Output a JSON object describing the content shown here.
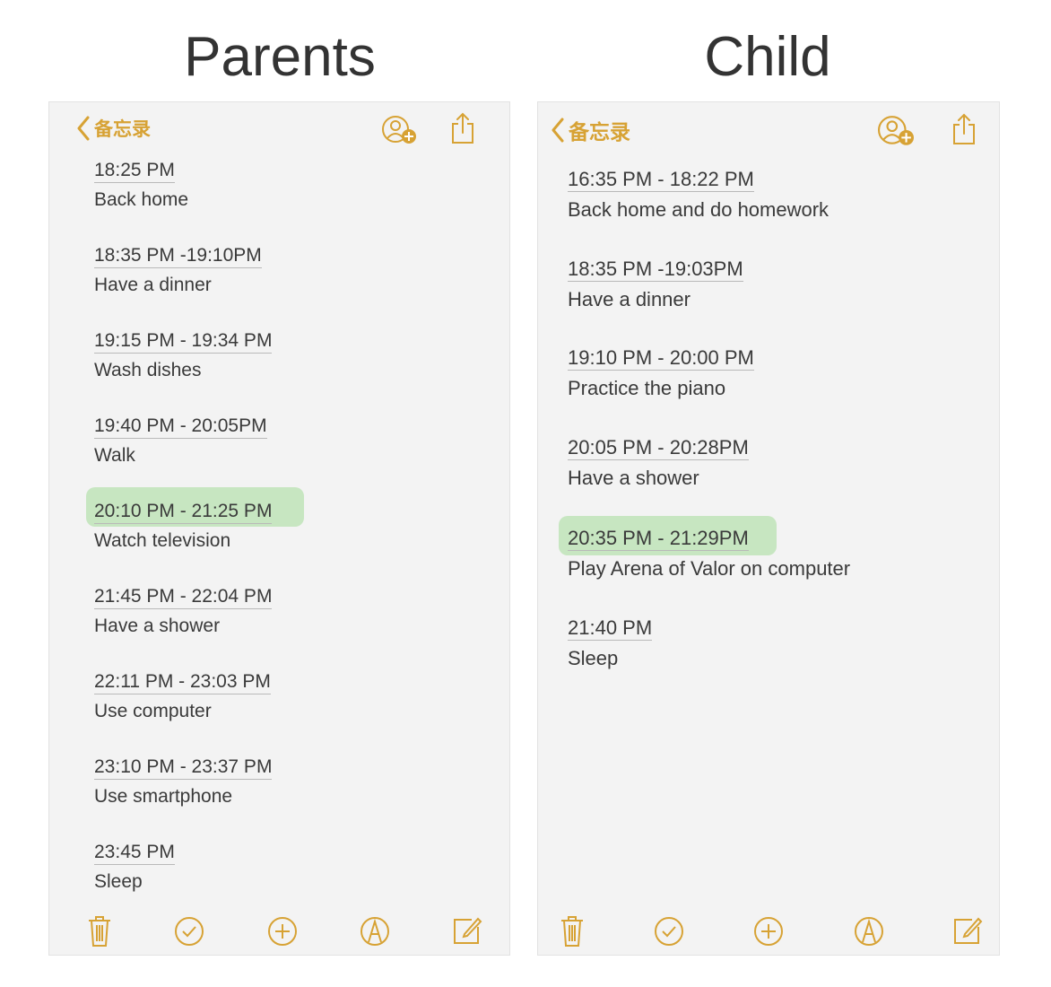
{
  "headings": {
    "left": "Parents",
    "right": "Child"
  },
  "colors": {
    "accent": "#d7a234",
    "highlight": "#c7e6c1",
    "paper": "#f3f3f3",
    "text": "#3a3a3a"
  },
  "parents": {
    "nav": {
      "back_label": "备忘录",
      "icons": [
        "chevron-left-icon",
        "add-person-icon",
        "share-icon"
      ]
    },
    "entries": [
      {
        "time": "18:25 PM",
        "activity": "Back home",
        "highlighted": false
      },
      {
        "time": "18:35 PM -19:10PM",
        "activity": "Have a dinner",
        "highlighted": false
      },
      {
        "time": "19:15 PM - 19:34 PM",
        "activity": "Wash dishes",
        "highlighted": false
      },
      {
        "time": "19:40 PM - 20:05PM",
        "activity": "Walk",
        "highlighted": false
      },
      {
        "time": "20:10 PM - 21:25 PM",
        "activity": "Watch television",
        "highlighted": true
      },
      {
        "time": "21:45 PM - 22:04 PM",
        "activity": "Have a shower",
        "highlighted": false
      },
      {
        "time": "22:11 PM - 23:03 PM",
        "activity": "Use computer",
        "highlighted": false
      },
      {
        "time": "23:10 PM - 23:37 PM",
        "activity": "Use smartphone",
        "highlighted": false
      },
      {
        "time": "23:45 PM",
        "activity": "Sleep",
        "highlighted": false
      }
    ],
    "toolbar": [
      "trash-icon",
      "checklist-icon",
      "add-icon",
      "markup-icon",
      "compose-icon"
    ]
  },
  "child": {
    "nav": {
      "back_label": "备忘录",
      "icons": [
        "chevron-left-icon",
        "add-person-icon",
        "share-icon"
      ]
    },
    "entries": [
      {
        "time": "16:35 PM - 18:22 PM",
        "activity": "Back home and do homework",
        "highlighted": false
      },
      {
        "time": "18:35 PM -19:03PM",
        "activity": "Have a dinner",
        "highlighted": false
      },
      {
        "time": "19:10 PM - 20:00 PM",
        "activity": "Practice the piano",
        "highlighted": false
      },
      {
        "time": "20:05 PM - 20:28PM",
        "activity": "Have a shower",
        "highlighted": false
      },
      {
        "time": "20:35 PM - 21:29PM",
        "activity": "Play Arena of Valor on computer",
        "highlighted": true
      },
      {
        "time": "21:40 PM",
        "activity": "Sleep",
        "highlighted": false
      }
    ],
    "toolbar": [
      "trash-icon",
      "checklist-icon",
      "add-icon",
      "markup-icon",
      "compose-icon"
    ]
  }
}
